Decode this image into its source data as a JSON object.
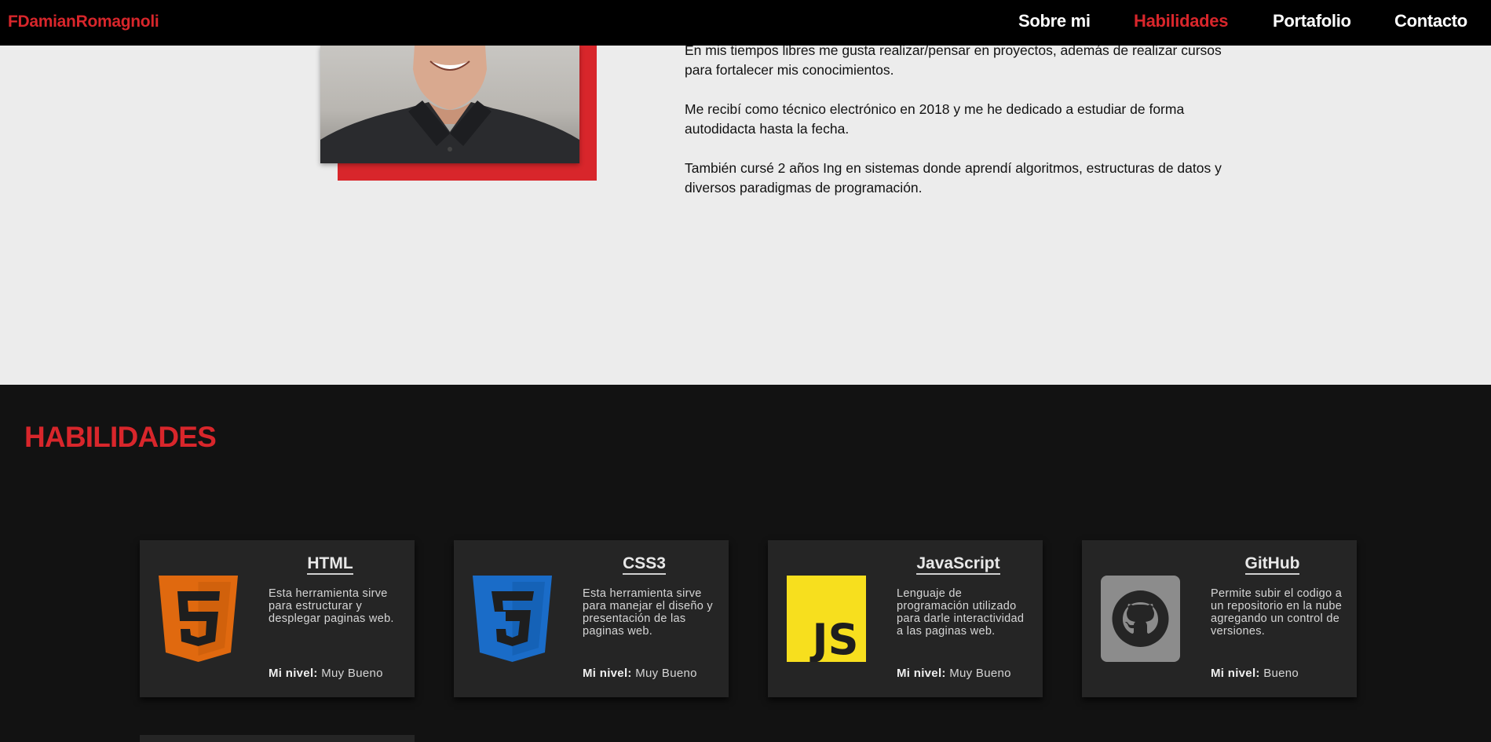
{
  "navbar": {
    "brand": "FDamianRomagnoli",
    "links": [
      {
        "label": "Sobre mi",
        "active": false
      },
      {
        "label": "Habilidades",
        "active": true
      },
      {
        "label": "Portafolio",
        "active": false
      },
      {
        "label": "Contacto",
        "active": false
      }
    ]
  },
  "about": {
    "paragraphs": [
      "En mis tiempos libres me gusta realizar/pensar en proyectos, además de realizar cursos para fortalecer mis conocimientos.",
      "Me recibí como técnico electrónico en 2018 y me he dedicado a estudiar de forma autodidacta hasta la fecha.",
      "También cursé 2 años Ing en sistemas donde aprendí algoritmos, estructuras de datos y diversos paradigmas de programación."
    ]
  },
  "skills": {
    "title": "HABILIDADES",
    "level_label": "Mi nivel:",
    "cards": [
      {
        "title": "HTML",
        "icon": "html5-icon",
        "description": "Esta herramienta sirve para estructurar y desplegar paginas web.",
        "level": "Muy Bueno"
      },
      {
        "title": "CSS3",
        "icon": "css3-icon",
        "description": "Esta herramienta sirve para manejar el diseño y presentación de las paginas web.",
        "level": "Muy Bueno"
      },
      {
        "title": "JavaScript",
        "icon": "javascript-icon",
        "description": "Lenguaje de programación utilizado para darle interactividad a las paginas web.",
        "level": "Muy Bueno"
      },
      {
        "title": "GitHub",
        "icon": "github-icon",
        "description": "Permite subir el codigo a un repositorio en la nube agregando un control de versiones.",
        "level": "Bueno"
      }
    ]
  },
  "colors": {
    "accent": "#d8262b",
    "navbar_bg": "#000000",
    "skills_bg": "#121212",
    "card_bg": "#252525",
    "html_orange": "#e0690f",
    "css_blue": "#1a6cc8",
    "js_yellow": "#f7df1e",
    "github_gray": "#8c8c8c"
  }
}
